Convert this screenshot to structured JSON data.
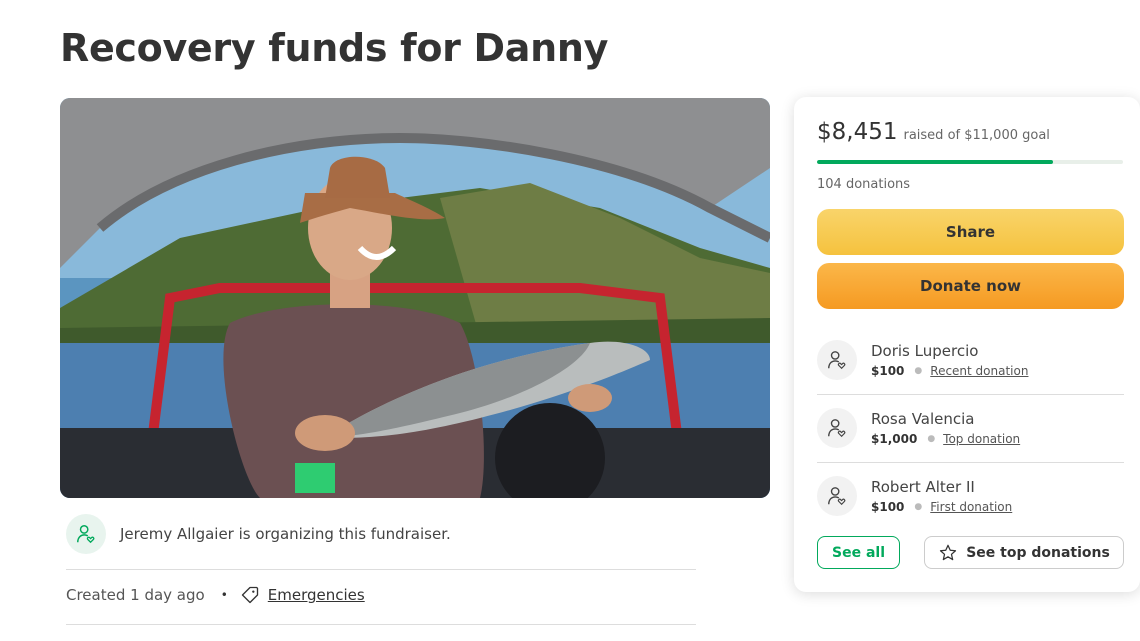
{
  "title": "Recovery funds for Danny",
  "organizer": {
    "text": "Jeremy Allgaier is organizing this fundraiser.",
    "icon": "user-heart-icon"
  },
  "meta": {
    "created": "Created 1 day ago",
    "separator": "•",
    "category": "Emergencies",
    "category_icon": "tag-icon"
  },
  "campaign": {
    "raised": "$8,451",
    "goal_text": "raised of $11,000 goal",
    "progress_fraction": 0.77,
    "donations_count": "104 donations"
  },
  "buttons": {
    "share": "Share",
    "donate": "Donate now",
    "see_all": "See all",
    "see_top": "See top donations"
  },
  "donors": [
    {
      "name": "Doris Lupercio",
      "amount": "$100",
      "type": "Recent donation"
    },
    {
      "name": "Rosa Valencia",
      "amount": "$1,000",
      "type": "Top donation"
    },
    {
      "name": "Robert Alter II",
      "amount": "$100",
      "type": "First donation"
    }
  ],
  "colors": {
    "accent_green": "#02a95c",
    "share_yellow": "#f7c948",
    "donate_orange": "#f7a42e"
  }
}
